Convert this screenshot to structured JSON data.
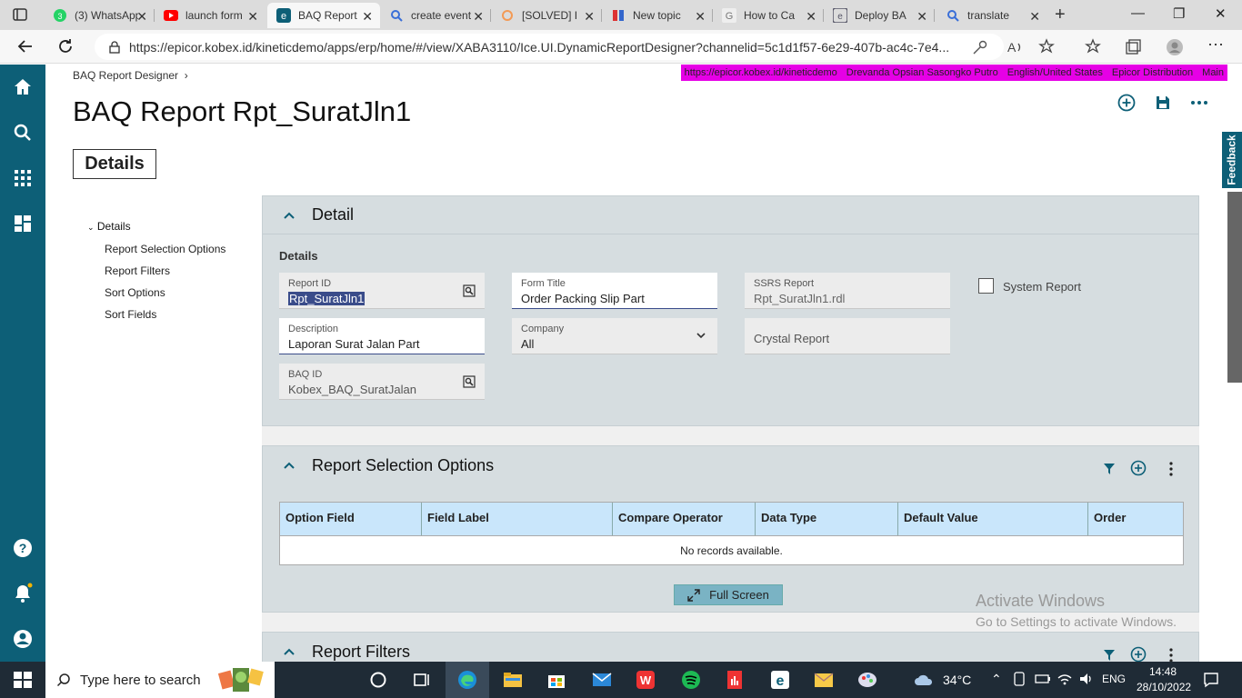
{
  "browser": {
    "tabs": [
      {
        "title": "(3) WhatsApp"
      },
      {
        "title": "launch form"
      },
      {
        "title": "BAQ Report"
      },
      {
        "title": "create event"
      },
      {
        "title": "[SOLVED] I"
      },
      {
        "title": "New topic"
      },
      {
        "title": "How to Ca"
      },
      {
        "title": "Deploy BA"
      },
      {
        "title": "translate"
      }
    ],
    "url": "https://epicor.kobex.id/kineticdemo/apps/erp/home/#/view/XABA3110/Ice.UI.DynamicReportDesigner?channelid=5c1d1f57-6e29-407b-ac4c-7e4..."
  },
  "header": {
    "breadcrumb": "BAQ Report Designer",
    "breadcrumb_sep": "›",
    "info": [
      "https://epicor.kobex.id/kineticdemo",
      "Drevanda Opsian Sasongko Putro",
      "English/United States",
      "Epicor Distribution",
      "Main"
    ],
    "page_title": "BAQ Report Rpt_SuratJln1",
    "details_button": "Details",
    "feedback": "Feedback"
  },
  "tree": {
    "root": "Details",
    "items": [
      "Report Selection Options",
      "Report Filters",
      "Sort Options",
      "Sort Fields"
    ]
  },
  "detail_card": {
    "title": "Detail",
    "section_label": "Details",
    "report_id": {
      "label": "Report ID",
      "value": "Rpt_SuratJln1"
    },
    "form_title": {
      "label": "Form Title",
      "value": "Order Packing Slip Part"
    },
    "ssrs_report": {
      "label": "SSRS Report",
      "value": "Rpt_SuratJln1.rdl"
    },
    "system_report": {
      "label": "System Report",
      "checked": false
    },
    "description": {
      "label": "Description",
      "value": "Laporan Surat Jalan Part"
    },
    "company": {
      "label": "Company",
      "value": "All"
    },
    "crystal_report": {
      "label": "Crystal Report"
    },
    "baq_id": {
      "label": "BAQ ID",
      "value": "Kobex_BAQ_SuratJalan"
    }
  },
  "selection_card": {
    "title": "Report Selection Options",
    "columns": [
      "Option Field",
      "Field Label",
      "Compare Operator",
      "Data Type",
      "Default Value",
      "Order"
    ],
    "empty_text": "No records available.",
    "full_screen": "Full Screen"
  },
  "filters_card": {
    "title": "Report Filters"
  },
  "watermark": {
    "line1": "Activate Windows",
    "line2": "Go to Settings to activate Windows."
  },
  "taskbar": {
    "search_placeholder": "Type here to search",
    "weather": "34°C",
    "lang": "ENG",
    "time": "14:48",
    "date": "28/10/2022"
  },
  "colors": {
    "nav": "#0d5f77",
    "accent": "#3a4c8a",
    "infobar": "#e600e6",
    "grid_header": "#c9e6fb"
  }
}
